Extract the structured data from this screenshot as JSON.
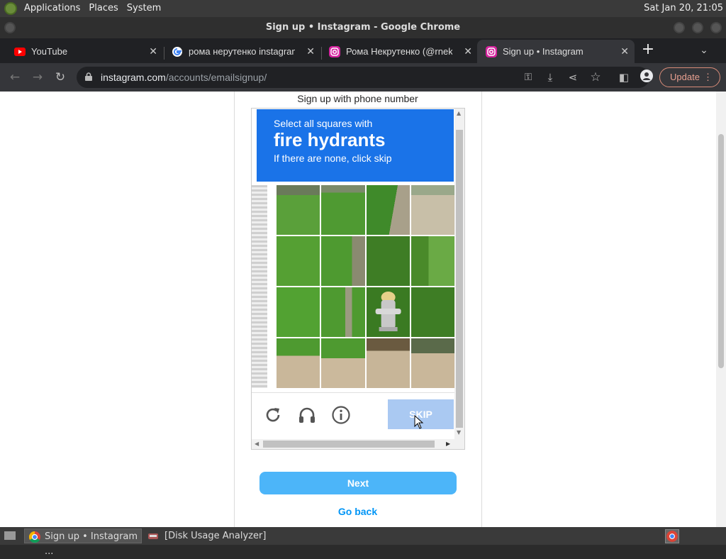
{
  "panel": {
    "applications": "Applications",
    "places": "Places",
    "system": "System",
    "clock": "Sat Jan 20, 21:05"
  },
  "window": {
    "title": "Sign up • Instagram - Google Chrome"
  },
  "tabs": [
    {
      "title": "YouTube",
      "icon": "youtube-icon"
    },
    {
      "title": "рома нерутенко instagram",
      "icon": "google-icon"
    },
    {
      "title": "Рома Некрутенко (@rnek",
      "icon": "instagram-icon"
    },
    {
      "title": "Sign up • Instagram",
      "icon": "instagram-icon"
    }
  ],
  "toolbar": {
    "url_host": "instagram.com",
    "url_path": "/accounts/emailsignup/",
    "update_label": "Update"
  },
  "page": {
    "phone_link": "Sign up with phone number",
    "captcha": {
      "instruction": "Select all squares with",
      "target": "fire hydrants",
      "hint": "If there are none, click skip",
      "skip_label": "SKIP"
    },
    "next_label": "Next",
    "go_back_label": "Go back"
  },
  "taskbar": {
    "chrome_task": "Sign up • Instagram ...",
    "disk_task": "[Disk Usage Analyzer]"
  },
  "colors": {
    "captcha_blue": "#1a73e8",
    "next_blue": "#4cb5f9",
    "link_blue": "#0095f6"
  }
}
